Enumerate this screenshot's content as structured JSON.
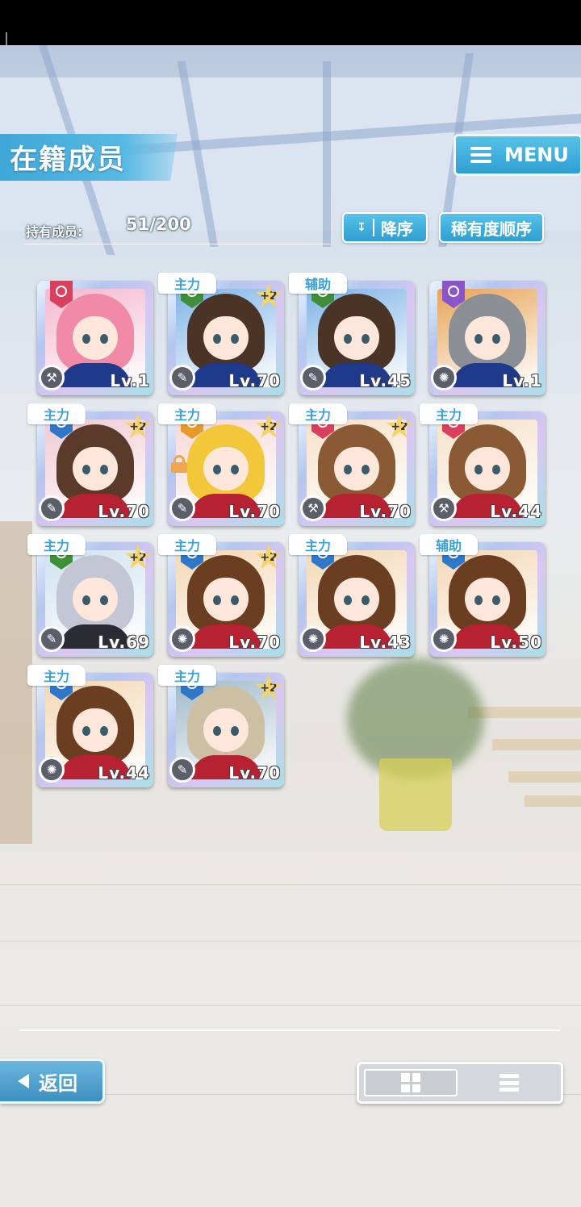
{
  "header": {
    "title": "在籍成员",
    "menu_label": "MENU",
    "count_label": "持有成员:",
    "count_value": "51/200",
    "sort_order_label": "降序",
    "sort_order_icon": "double-chevron-down-icon",
    "sort_key_label": "稀有度顺序"
  },
  "cards": [
    {
      "role": "",
      "level": "Lv.1",
      "plus": "",
      "attr_color": "#d8405e",
      "skill_icon": "hammer-icon",
      "skill_glyph": "⚒",
      "hair": "#f08aa6",
      "body": "#1f3a8a",
      "bg": "#f3b7cf",
      "locked": false
    },
    {
      "role": "主力",
      "level": "Lv.70",
      "plus": "+2",
      "attr_color": "#3f8f3a",
      "skill_icon": "feather-icon",
      "skill_glyph": "✎",
      "hair": "#4a3426",
      "body": "#1f3a8a",
      "bg": "#7fb4e6",
      "locked": false
    },
    {
      "role": "辅助",
      "level": "Lv.45",
      "plus": "",
      "attr_color": "#3f8f3a",
      "skill_icon": "feather-icon",
      "skill_glyph": "✎",
      "hair": "#4a3426",
      "body": "#1f3a8a",
      "bg": "#7fb4e6",
      "locked": false
    },
    {
      "role": "",
      "level": "Lv.1",
      "plus": "",
      "attr_color": "#8a55c9",
      "skill_icon": "gear-icon",
      "skill_glyph": "✺",
      "hair": "#8a8f95",
      "body": "#1f3a8a",
      "bg": "#e7a458",
      "locked": false
    },
    {
      "role": "主力",
      "level": "Lv.70",
      "plus": "+2",
      "attr_color": "#2f78c8",
      "skill_icon": "feather-icon",
      "skill_glyph": "✎",
      "hair": "#5a3b2a",
      "body": "#b72232",
      "bg": "#f0c9d3",
      "locked": false
    },
    {
      "role": "主力",
      "level": "Lv.70",
      "plus": "+2",
      "attr_color": "#e79a2a",
      "skill_icon": "feather-icon",
      "skill_glyph": "✎",
      "hair": "#f2c83a",
      "body": "#b72232",
      "bg": "#f6d8d8",
      "locked": true
    },
    {
      "role": "主力",
      "level": "Lv.70",
      "plus": "+2",
      "attr_color": "#d8405e",
      "skill_icon": "hammer-icon",
      "skill_glyph": "⚒",
      "hair": "#8a5a34",
      "body": "#b72232",
      "bg": "#f6e1c8",
      "locked": false
    },
    {
      "role": "主力",
      "level": "Lv.44",
      "plus": "",
      "attr_color": "#d8405e",
      "skill_icon": "hammer-icon",
      "skill_glyph": "⚒",
      "hair": "#8a5a34",
      "body": "#b72232",
      "bg": "#f6e1c8",
      "locked": false
    },
    {
      "role": "主力",
      "level": "Lv.69",
      "plus": "+2",
      "attr_color": "#3f8f3a",
      "skill_icon": "feather-icon",
      "skill_glyph": "✎",
      "hair": "#c3c6d4",
      "body": "#2b2b33",
      "bg": "#cfe2f0",
      "locked": false
    },
    {
      "role": "主力",
      "level": "Lv.70",
      "plus": "+2",
      "attr_color": "#2f78c8",
      "skill_icon": "gear-icon",
      "skill_glyph": "✺",
      "hair": "#6b3e22",
      "body": "#b72232",
      "bg": "#f3d7b4",
      "locked": false
    },
    {
      "role": "主力",
      "level": "Lv.43",
      "plus": "",
      "attr_color": "#2f78c8",
      "skill_icon": "gear-icon",
      "skill_glyph": "✺",
      "hair": "#6b3e22",
      "body": "#b72232",
      "bg": "#f3d7b4",
      "locked": false
    },
    {
      "role": "辅助",
      "level": "Lv.50",
      "plus": "",
      "attr_color": "#2f78c8",
      "skill_icon": "gear-icon",
      "skill_glyph": "✺",
      "hair": "#6b3e22",
      "body": "#b72232",
      "bg": "#f3d7b4",
      "locked": false
    },
    {
      "role": "主力",
      "level": "Lv.44",
      "plus": "",
      "attr_color": "#2f78c8",
      "skill_icon": "gear-icon",
      "skill_glyph": "✺",
      "hair": "#6b3e22",
      "body": "#b72232",
      "bg": "#f3d7b4",
      "locked": false
    },
    {
      "role": "主力",
      "level": "Lv.70",
      "plus": "+2",
      "attr_color": "#2f78c8",
      "skill_icon": "feather-icon",
      "skill_glyph": "✎",
      "hair": "#cdbfa4",
      "body": "#b72232",
      "bg": "#9fb9c8",
      "locked": false
    }
  ],
  "footer": {
    "back_label": "返回",
    "back_icon": "triangle-left-icon",
    "view_grid_icon": "grid-view-icon",
    "view_list_icon": "list-view-icon",
    "selected_view": "grid"
  }
}
